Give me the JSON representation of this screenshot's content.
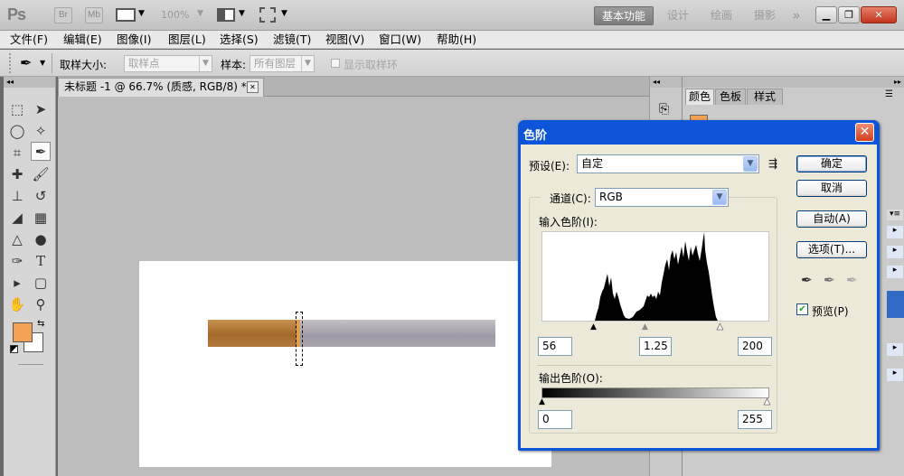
{
  "appbar": {
    "logo": "Ps",
    "br": "Br",
    "mb": "Mb",
    "zoom": "100%",
    "workspaces": [
      "基本功能",
      "设计",
      "绘画",
      "摄影"
    ],
    "more": "»"
  },
  "menu": [
    "文件(F)",
    "编辑(E)",
    "图像(I)",
    "图层(L)",
    "选择(S)",
    "滤镜(T)",
    "视图(V)",
    "窗口(W)",
    "帮助(H)"
  ],
  "options": {
    "sample_size_label": "取样大小:",
    "sample_size_value": "取样点",
    "sample_label": "样本:",
    "sample_value": "所有图层",
    "show_ring_label": "显示取样环"
  },
  "document": {
    "tab_title": "未标题 -1 @ 66.7% (质感, RGB/8) *",
    "tab_close": "✕"
  },
  "panels": {
    "tabs": [
      "颜色",
      "色板",
      "样式"
    ]
  },
  "dialog": {
    "title": "色阶",
    "preset_label": "预设(E):",
    "preset_value": "自定",
    "channel_label": "通道(C):",
    "channel_value": "RGB",
    "input_levels_label": "输入色阶(I):",
    "input_black": "56",
    "input_gamma": "1.25",
    "input_white": "200",
    "output_levels_label": "输出色阶(O):",
    "output_black": "0",
    "output_white": "255",
    "buttons": {
      "ok": "确定",
      "cancel": "取消",
      "auto": "自动(A)",
      "options": "选项(T)..."
    },
    "preview_label": "预览(P)",
    "preview_checked": true
  },
  "colors": {
    "foreground": "#f6a255",
    "background": "#ffffff",
    "dialog_frame": "#0d55d8"
  }
}
